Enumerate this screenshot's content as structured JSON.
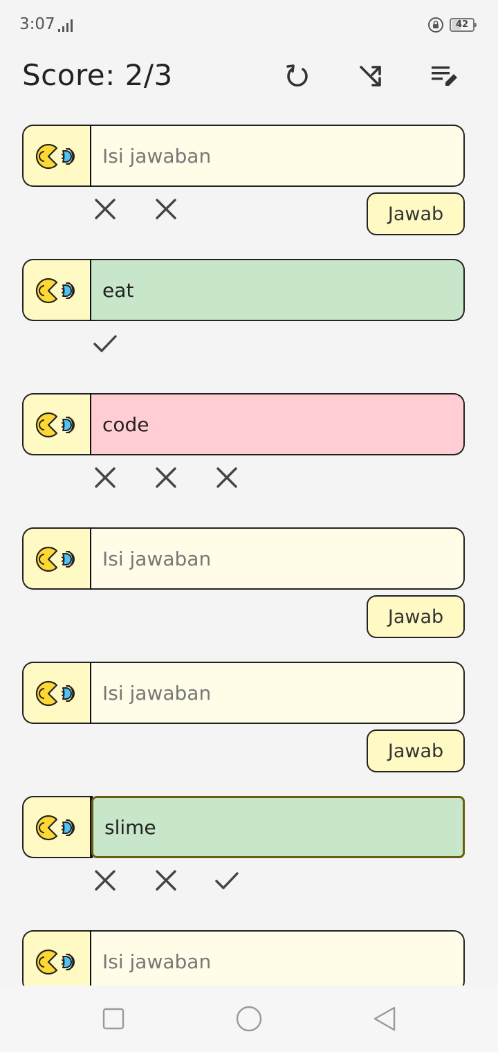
{
  "status": {
    "time": "3:07",
    "battery": "42",
    "battery_level": 0.42
  },
  "header": {
    "score": "Score: 2/3"
  },
  "placeholder": "Isi jawaban",
  "button_label": "Jawab",
  "cards": [
    {
      "state": "empty",
      "value": "",
      "marks": [
        "x",
        "x"
      ],
      "show_button": true
    },
    {
      "state": "correct",
      "value": "eat",
      "marks": [
        "check"
      ],
      "show_button": false
    },
    {
      "state": "wrong",
      "value": "code",
      "marks": [
        "x",
        "x",
        "x"
      ],
      "show_button": false
    },
    {
      "state": "empty",
      "value": "",
      "marks": [],
      "show_button": true
    },
    {
      "state": "empty",
      "value": "",
      "marks": [],
      "show_button": true
    },
    {
      "state": "correct",
      "value": "slime",
      "marks": [
        "x",
        "x",
        "check"
      ],
      "show_button": false,
      "focused": true
    },
    {
      "state": "empty",
      "value": "",
      "marks": [],
      "show_button": false
    }
  ],
  "icons": {
    "speaker": "pacman-sound-icon",
    "refresh": "refresh-icon",
    "shuffle": "shuffle-icon",
    "edit": "edit-list-icon"
  },
  "colors": {
    "button_bg": "#fff9c4",
    "correct_bg": "#c8e6c9",
    "wrong_bg": "#ffcdd2",
    "empty_bg": "#fffde7"
  }
}
